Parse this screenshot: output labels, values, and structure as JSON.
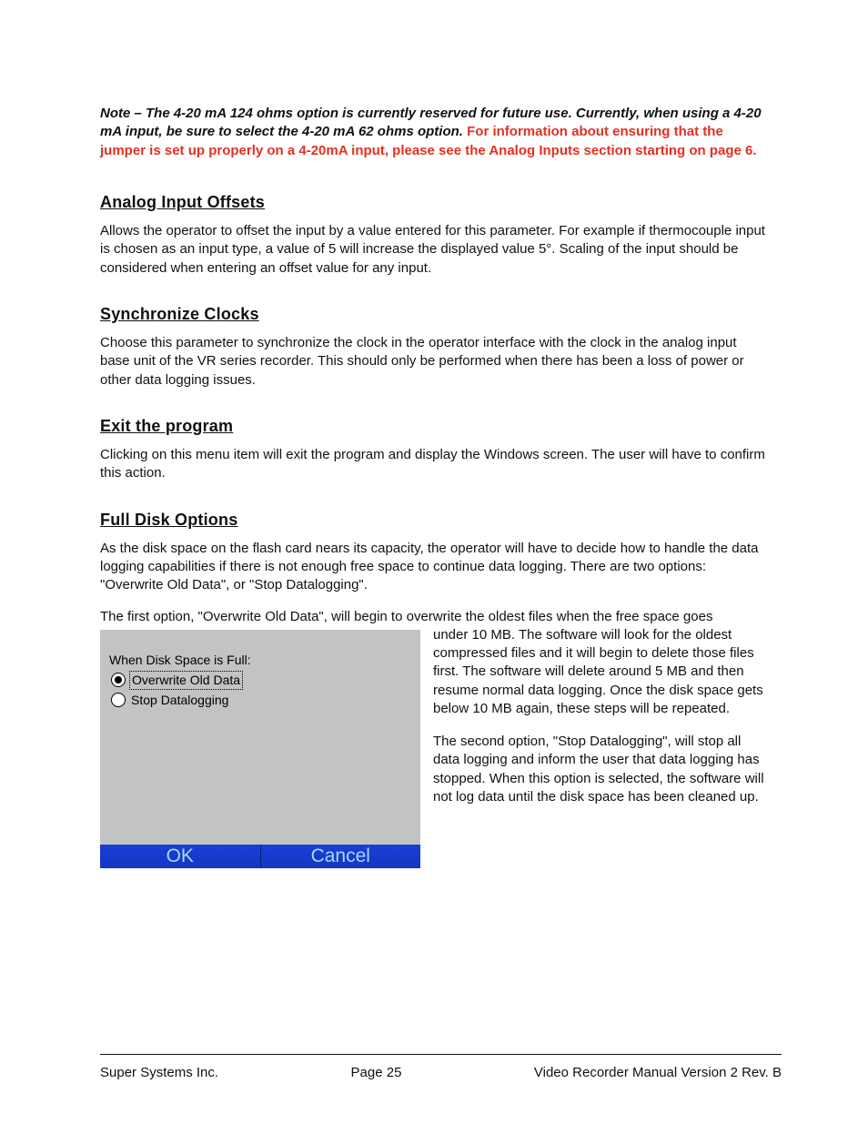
{
  "note": {
    "italic": "Note – The 4-20 mA 124 ohms option is currently reserved for future use.  Currently, when using a 4-20 mA input, be sure to select the 4-20 mA 62 ohms option",
    "italic_trail": ".  ",
    "red": "For information about ensuring that the jumper is set up properly on a 4-20mA input, please see the Analog Inputs section starting on page 6."
  },
  "sections": {
    "analog": {
      "heading": "Analog Input Offsets",
      "body": "Allows the operator to offset the input by a value entered for this parameter.  For example if thermocouple input is chosen as an input type, a value of 5 will increase the displayed value 5°.  Scaling of the input should be considered when entering an offset value for any input."
    },
    "sync": {
      "heading": "Synchronize Clocks",
      "body": "Choose this parameter to synchronize the clock in the operator interface with the clock in the analog input base unit of the VR series recorder.  This should only be performed when there has been a loss of power or other data logging issues."
    },
    "exit": {
      "heading": "Exit the program",
      "body": "Clicking on this menu item will exit the program and display the Windows screen.  The user will have to confirm this action."
    },
    "fulldisk": {
      "heading": "Full Disk Options",
      "intro": "As the disk space on the flash card nears its capacity, the operator will have to decide how to handle the data logging capabilities if there is not enough free space to continue data logging.  There are two options: \"Overwrite Old Data\", or \"Stop Datalogging\".",
      "lead": "The first option, \"Overwrite Old Data\", will begin to overwrite the oldest files when the free space goes ",
      "right_p1": "under 10 MB.  The software will look for the oldest compressed files and it will begin to delete those files first.  The software will delete around 5 MB and then resume normal data logging.  Once the disk space gets below 10 MB again, these steps will be repeated.",
      "right_p2": "The second option, \"Stop Datalogging\", will stop all data logging and inform the user that data logging has stopped.  When this option is selected, the software will not log data until the disk space has been cleaned up."
    }
  },
  "dialog": {
    "title": "When Disk Space is Full:",
    "option1": "Overwrite Old Data",
    "option2": "Stop Datalogging",
    "ok": "OK",
    "cancel": "Cancel"
  },
  "footer": {
    "left": "Super Systems Inc.",
    "center": "Page 25",
    "right": "Video Recorder Manual Version 2 Rev. B"
  }
}
